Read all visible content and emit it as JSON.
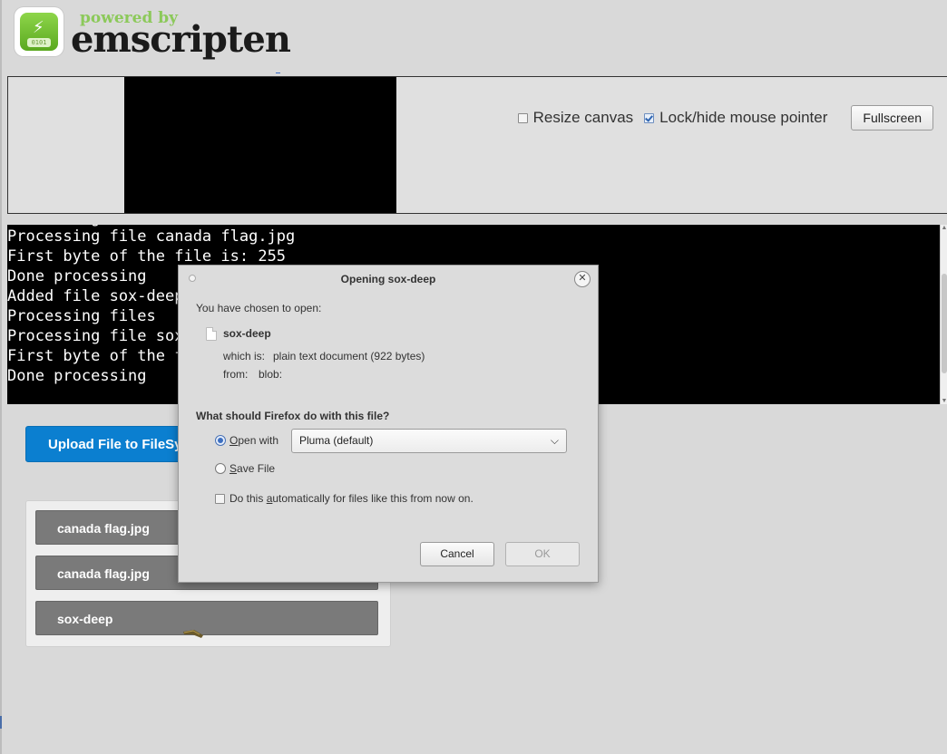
{
  "logo": {
    "powered_by": "powered by",
    "name": "emscripten",
    "chip_text": "0101"
  },
  "controls": {
    "resize_canvas_label": "Resize canvas",
    "resize_canvas_checked": false,
    "lock_pointer_label": "Lock/hide mouse pointer",
    "lock_pointer_checked": true,
    "fullscreen_label": "Fullscreen"
  },
  "console": {
    "lines": [
      "Processing file canada flag.jpg",
      "First byte of the file is: 255",
      "Done processing",
      "Added file sox-deep",
      "Processing files",
      "Processing file sox",
      "First byte of the f",
      "Done processing"
    ]
  },
  "upload": {
    "label": "Upload File to FileSy"
  },
  "files": [
    {
      "name": "canada flag.jpg"
    },
    {
      "name": "canada flag.jpg"
    },
    {
      "name": "sox-deep"
    }
  ],
  "dialog": {
    "title": "Opening sox-deep",
    "intro": "You have chosen to open:",
    "file_name": "sox-deep",
    "which_is_label": "which is:",
    "which_is_value": "plain text document (922 bytes)",
    "from_label": "from:",
    "from_value": "blob:",
    "question": "What should Firefox do with this file?",
    "open_with_prefix": "O",
    "open_with_rest": "pen with",
    "open_with_selected": true,
    "app_selected": "Pluma (default)",
    "save_file_prefix": "S",
    "save_file_rest": "ave File",
    "auto_prefix": "Do this ",
    "auto_mnemonic": "a",
    "auto_rest": "utomatically for files like this from now on.",
    "auto_checked": false,
    "cancel_label": "Cancel",
    "ok_label": "OK"
  }
}
